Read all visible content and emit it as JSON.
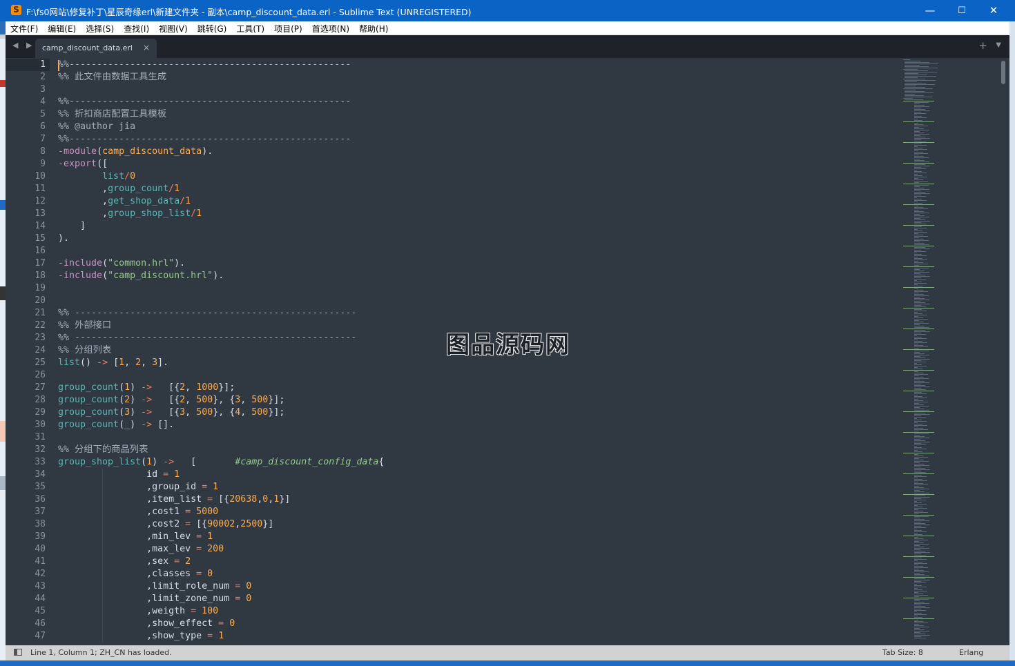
{
  "window": {
    "title": "F:\\fs0网站\\修复补丁\\星辰奇缘erl\\新建文件夹 - 副本\\camp_discount_data.erl - Sublime Text (UNREGISTERED)",
    "minimize": "—",
    "maximize": "☐",
    "close": "✕"
  },
  "menu": [
    "文件(F)",
    "编辑(E)",
    "选择(S)",
    "查找(I)",
    "视图(V)",
    "跳转(G)",
    "工具(T)",
    "项目(P)",
    "首选项(N)",
    "帮助(H)"
  ],
  "tabs": {
    "nav": "◀ ▶",
    "active": "camp_discount_data.erl",
    "close": "×",
    "new_tab": "+",
    "menu": "▼"
  },
  "editor": {
    "current_line": 1,
    "lines": [
      [
        [
          "c-cm",
          "%%---------------------------------------------------"
        ]
      ],
      [
        [
          "c-cm",
          "%% 此文件由数据工具生成"
        ]
      ],
      [],
      [
        [
          "c-cm",
          "%%---------------------------------------------------"
        ]
      ],
      [
        [
          "c-cm",
          "%% 折扣商店配置工具模板"
        ]
      ],
      [
        [
          "c-cm",
          "%% @author jia"
        ]
      ],
      [
        [
          "c-cm",
          "%%---------------------------------------------------"
        ]
      ],
      [
        [
          "c-op",
          "-"
        ],
        [
          "c-mod",
          "module"
        ],
        [
          "c-pl",
          "("
        ],
        [
          "c-num",
          "camp_discount_data"
        ],
        [
          "c-pl",
          ")."
        ]
      ],
      [
        [
          "c-op",
          "-"
        ],
        [
          "c-mod",
          "export"
        ],
        [
          "c-pl",
          "(["
        ]
      ],
      [
        [
          "c-pl",
          "        "
        ],
        [
          "c-fn",
          "list"
        ],
        [
          "c-op",
          "/"
        ],
        [
          "c-num",
          "0"
        ]
      ],
      [
        [
          "c-pl",
          "        ,"
        ],
        [
          "c-fn",
          "group_count"
        ],
        [
          "c-op",
          "/"
        ],
        [
          "c-num",
          "1"
        ]
      ],
      [
        [
          "c-pl",
          "        ,"
        ],
        [
          "c-fn",
          "get_shop_data"
        ],
        [
          "c-op",
          "/"
        ],
        [
          "c-num",
          "1"
        ]
      ],
      [
        [
          "c-pl",
          "        ,"
        ],
        [
          "c-fn",
          "group_shop_list"
        ],
        [
          "c-op",
          "/"
        ],
        [
          "c-num",
          "1"
        ]
      ],
      [
        [
          "c-pl",
          "    ]"
        ]
      ],
      [
        [
          "c-pl",
          ")."
        ]
      ],
      [],
      [
        [
          "c-op",
          "-"
        ],
        [
          "c-mod",
          "include"
        ],
        [
          "c-pl",
          "("
        ],
        [
          "c-str",
          "\"common.hrl\""
        ],
        [
          "c-pl",
          ")."
        ]
      ],
      [
        [
          "c-op",
          "-"
        ],
        [
          "c-mod",
          "include"
        ],
        [
          "c-pl",
          "("
        ],
        [
          "c-str",
          "\"camp_discount.hrl\""
        ],
        [
          "c-pl",
          ")."
        ]
      ],
      [],
      [],
      [
        [
          "c-cm",
          "%% ---------------------------------------------------"
        ]
      ],
      [
        [
          "c-cm",
          "%% 外部接口"
        ]
      ],
      [
        [
          "c-cm",
          "%% ---------------------------------------------------"
        ]
      ],
      [
        [
          "c-cm",
          "%% 分组列表"
        ]
      ],
      [
        [
          "c-fn",
          "list"
        ],
        [
          "c-pl",
          "() "
        ],
        [
          "c-op",
          "->"
        ],
        [
          "c-pl",
          " ["
        ],
        [
          "c-num",
          "1"
        ],
        [
          "c-pl",
          ", "
        ],
        [
          "c-num",
          "2"
        ],
        [
          "c-pl",
          ", "
        ],
        [
          "c-num",
          "3"
        ],
        [
          "c-pl",
          "]."
        ]
      ],
      [],
      [
        [
          "c-fn",
          "group_count"
        ],
        [
          "c-pl",
          "("
        ],
        [
          "c-num",
          "1"
        ],
        [
          "c-pl",
          ") "
        ],
        [
          "c-op",
          "->"
        ],
        [
          "c-pl",
          "   [{"
        ],
        [
          "c-num",
          "2"
        ],
        [
          "c-pl",
          ", "
        ],
        [
          "c-num",
          "1000"
        ],
        [
          "c-pl",
          "}];"
        ]
      ],
      [
        [
          "c-fn",
          "group_count"
        ],
        [
          "c-pl",
          "("
        ],
        [
          "c-num",
          "2"
        ],
        [
          "c-pl",
          ") "
        ],
        [
          "c-op",
          "->"
        ],
        [
          "c-pl",
          "   [{"
        ],
        [
          "c-num",
          "2"
        ],
        [
          "c-pl",
          ", "
        ],
        [
          "c-num",
          "500"
        ],
        [
          "c-pl",
          "}, {"
        ],
        [
          "c-num",
          "3"
        ],
        [
          "c-pl",
          ", "
        ],
        [
          "c-num",
          "500"
        ],
        [
          "c-pl",
          "}];"
        ]
      ],
      [
        [
          "c-fn",
          "group_count"
        ],
        [
          "c-pl",
          "("
        ],
        [
          "c-num",
          "3"
        ],
        [
          "c-pl",
          ") "
        ],
        [
          "c-op",
          "->"
        ],
        [
          "c-pl",
          "   [{"
        ],
        [
          "c-num",
          "3"
        ],
        [
          "c-pl",
          ", "
        ],
        [
          "c-num",
          "500"
        ],
        [
          "c-pl",
          "}, {"
        ],
        [
          "c-num",
          "4"
        ],
        [
          "c-pl",
          ", "
        ],
        [
          "c-num",
          "500"
        ],
        [
          "c-pl",
          "}];"
        ]
      ],
      [
        [
          "c-fn",
          "group_count"
        ],
        [
          "c-pl",
          "("
        ],
        [
          "c-num",
          "_"
        ],
        [
          "c-pl",
          ") "
        ],
        [
          "c-op",
          "->"
        ],
        [
          "c-pl",
          " []."
        ]
      ],
      [],
      [
        [
          "c-cm",
          "%% 分组下的商品列表"
        ]
      ],
      [
        [
          "c-fn",
          "group_shop_list"
        ],
        [
          "c-pl",
          "("
        ],
        [
          "c-num",
          "1"
        ],
        [
          "c-pl",
          ") "
        ],
        [
          "c-op",
          "->"
        ],
        [
          "c-pl",
          "   [       "
        ],
        [
          "c-rec",
          "#camp_discount_config_data"
        ],
        [
          "c-pl",
          "{"
        ]
      ],
      [
        [
          "c-pl",
          "                "
        ],
        [
          "c-pl",
          "id "
        ],
        [
          "c-op",
          "="
        ],
        [
          "c-pl",
          " "
        ],
        [
          "c-num",
          "1"
        ]
      ],
      [
        [
          "c-pl",
          "                ,group_id "
        ],
        [
          "c-op",
          "="
        ],
        [
          "c-pl",
          " "
        ],
        [
          "c-num",
          "1"
        ]
      ],
      [
        [
          "c-pl",
          "                ,item_list "
        ],
        [
          "c-op",
          "="
        ],
        [
          "c-pl",
          " [{"
        ],
        [
          "c-num",
          "20638"
        ],
        [
          "c-pl",
          ","
        ],
        [
          "c-num",
          "0"
        ],
        [
          "c-pl",
          ","
        ],
        [
          "c-num",
          "1"
        ],
        [
          "c-pl",
          "}]"
        ]
      ],
      [
        [
          "c-pl",
          "                ,cost1 "
        ],
        [
          "c-op",
          "="
        ],
        [
          "c-pl",
          " "
        ],
        [
          "c-num",
          "5000"
        ]
      ],
      [
        [
          "c-pl",
          "                ,cost2 "
        ],
        [
          "c-op",
          "="
        ],
        [
          "c-pl",
          " [{"
        ],
        [
          "c-num",
          "90002"
        ],
        [
          "c-pl",
          ","
        ],
        [
          "c-num",
          "2500"
        ],
        [
          "c-pl",
          "}]"
        ]
      ],
      [
        [
          "c-pl",
          "                ,min_lev "
        ],
        [
          "c-op",
          "="
        ],
        [
          "c-pl",
          " "
        ],
        [
          "c-num",
          "1"
        ]
      ],
      [
        [
          "c-pl",
          "                ,max_lev "
        ],
        [
          "c-op",
          "="
        ],
        [
          "c-pl",
          " "
        ],
        [
          "c-num",
          "200"
        ]
      ],
      [
        [
          "c-pl",
          "                ,sex "
        ],
        [
          "c-op",
          "="
        ],
        [
          "c-pl",
          " "
        ],
        [
          "c-num",
          "2"
        ]
      ],
      [
        [
          "c-pl",
          "                ,classes "
        ],
        [
          "c-op",
          "="
        ],
        [
          "c-pl",
          " "
        ],
        [
          "c-num",
          "0"
        ]
      ],
      [
        [
          "c-pl",
          "                ,limit_role_num "
        ],
        [
          "c-op",
          "="
        ],
        [
          "c-pl",
          " "
        ],
        [
          "c-num",
          "0"
        ]
      ],
      [
        [
          "c-pl",
          "                ,limit_zone_num "
        ],
        [
          "c-op",
          "="
        ],
        [
          "c-pl",
          " "
        ],
        [
          "c-num",
          "0"
        ]
      ],
      [
        [
          "c-pl",
          "                ,weigth "
        ],
        [
          "c-op",
          "="
        ],
        [
          "c-pl",
          " "
        ],
        [
          "c-num",
          "100"
        ]
      ],
      [
        [
          "c-pl",
          "                ,show_effect "
        ],
        [
          "c-op",
          "="
        ],
        [
          "c-pl",
          " "
        ],
        [
          "c-num",
          "0"
        ]
      ],
      [
        [
          "c-pl",
          "                ,show_type "
        ],
        [
          "c-op",
          "="
        ],
        [
          "c-pl",
          " "
        ],
        [
          "c-num",
          "1"
        ]
      ]
    ]
  },
  "watermark": "converting",
  "watermark_text": "图品源码网",
  "status": {
    "message": "Line 1, Column 1; ZH_CN has loaded.",
    "tab_size": "Tab Size: 8",
    "syntax": "Erlang"
  }
}
